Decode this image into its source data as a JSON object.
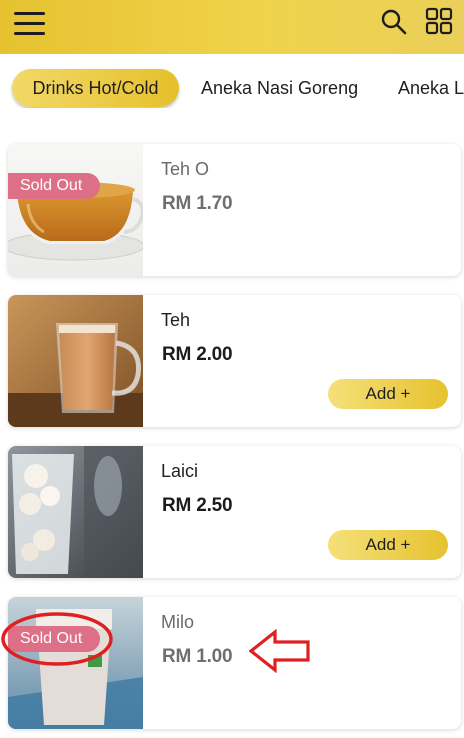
{
  "header": {
    "menu_icon": "hamburger-menu-icon",
    "search_icon": "search-icon",
    "grid_icon": "grid-view-icon"
  },
  "tabs": [
    {
      "label": "Drinks Hot/Cold",
      "active": true
    },
    {
      "label": "Aneka Nasi Goreng",
      "active": false
    },
    {
      "label": "Aneka L",
      "active": false
    }
  ],
  "products": [
    {
      "name": "Teh O",
      "price": "RM 1.70",
      "sold_out": true,
      "badge": "Sold Out"
    },
    {
      "name": "Teh",
      "price": "RM 2.00",
      "sold_out": false,
      "add_label": "Add +"
    },
    {
      "name": "Laici",
      "price": "RM 2.50",
      "sold_out": false,
      "add_label": "Add +"
    },
    {
      "name": "Milo",
      "price": "RM 1.00",
      "sold_out": true,
      "badge": "Sold Out"
    }
  ],
  "colors": {
    "brand_yellow": "#e6c230",
    "sold_out_badge": "#dd6f86",
    "annotation_red": "#e02020"
  }
}
